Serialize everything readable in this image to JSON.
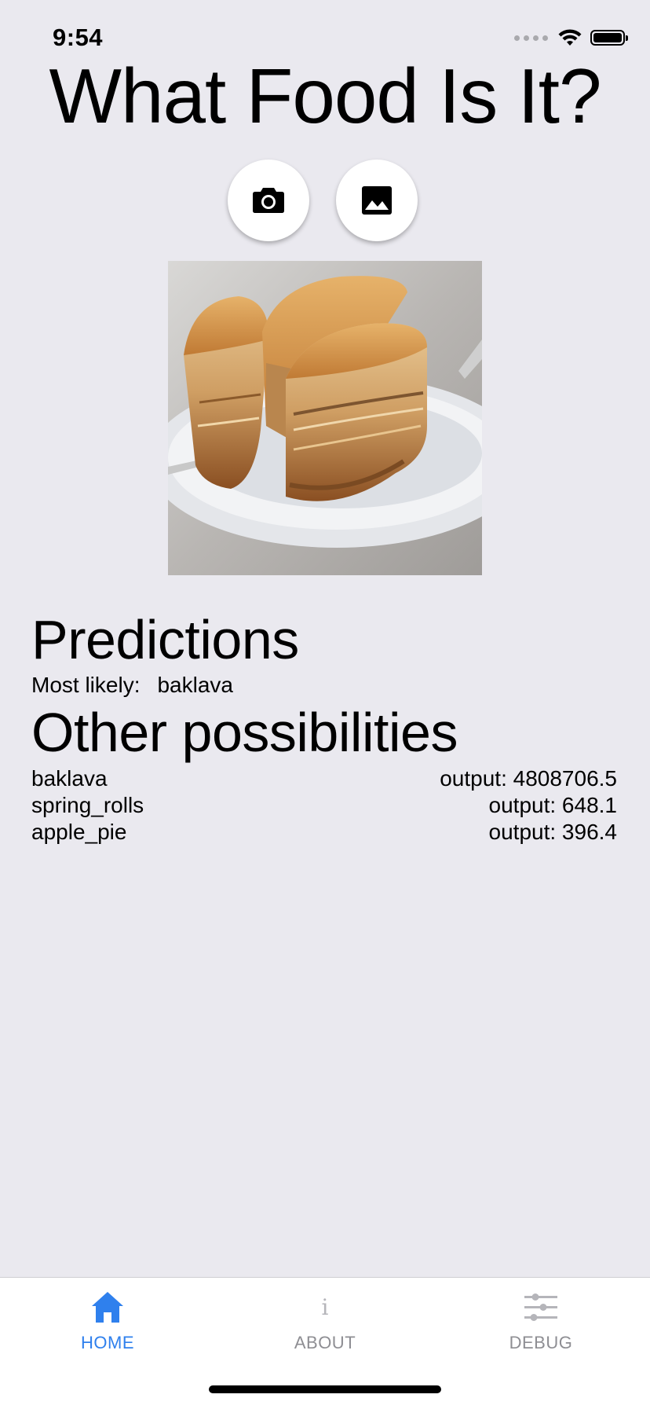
{
  "status_bar": {
    "time": "9:54",
    "icons": [
      "cellular-signal-icon",
      "wifi-icon",
      "battery-icon"
    ]
  },
  "app_title": "What Food Is It?",
  "actions": [
    {
      "id": "camera",
      "icon": "camera-icon"
    },
    {
      "id": "gallery",
      "icon": "image-gallery-icon"
    }
  ],
  "image": {
    "subject": "baklava-photo"
  },
  "predictions": {
    "title": "Predictions",
    "most_likely_label": "Most likely:",
    "most_likely_value": "baklava"
  },
  "other_possibilities": {
    "title": "Other possibilities",
    "rows": [
      {
        "label": "baklava",
        "output": "output: 4808706.5"
      },
      {
        "label": "spring_rolls",
        "output": "output: 648.1"
      },
      {
        "label": "apple_pie",
        "output": "output: 396.4"
      }
    ]
  },
  "tab_bar": {
    "active": "home",
    "tabs": [
      {
        "id": "home",
        "label": "HOME",
        "icon": "home-icon"
      },
      {
        "id": "about",
        "label": "ABOUT",
        "icon": "info-icon",
        "glyph": "i"
      },
      {
        "id": "debug",
        "label": "DEBUG",
        "icon": "sliders-icon"
      }
    ]
  },
  "colors": {
    "background": "#EAE9EF",
    "accent": "#2F80ED",
    "inactive_tab": "#8E8E93"
  }
}
